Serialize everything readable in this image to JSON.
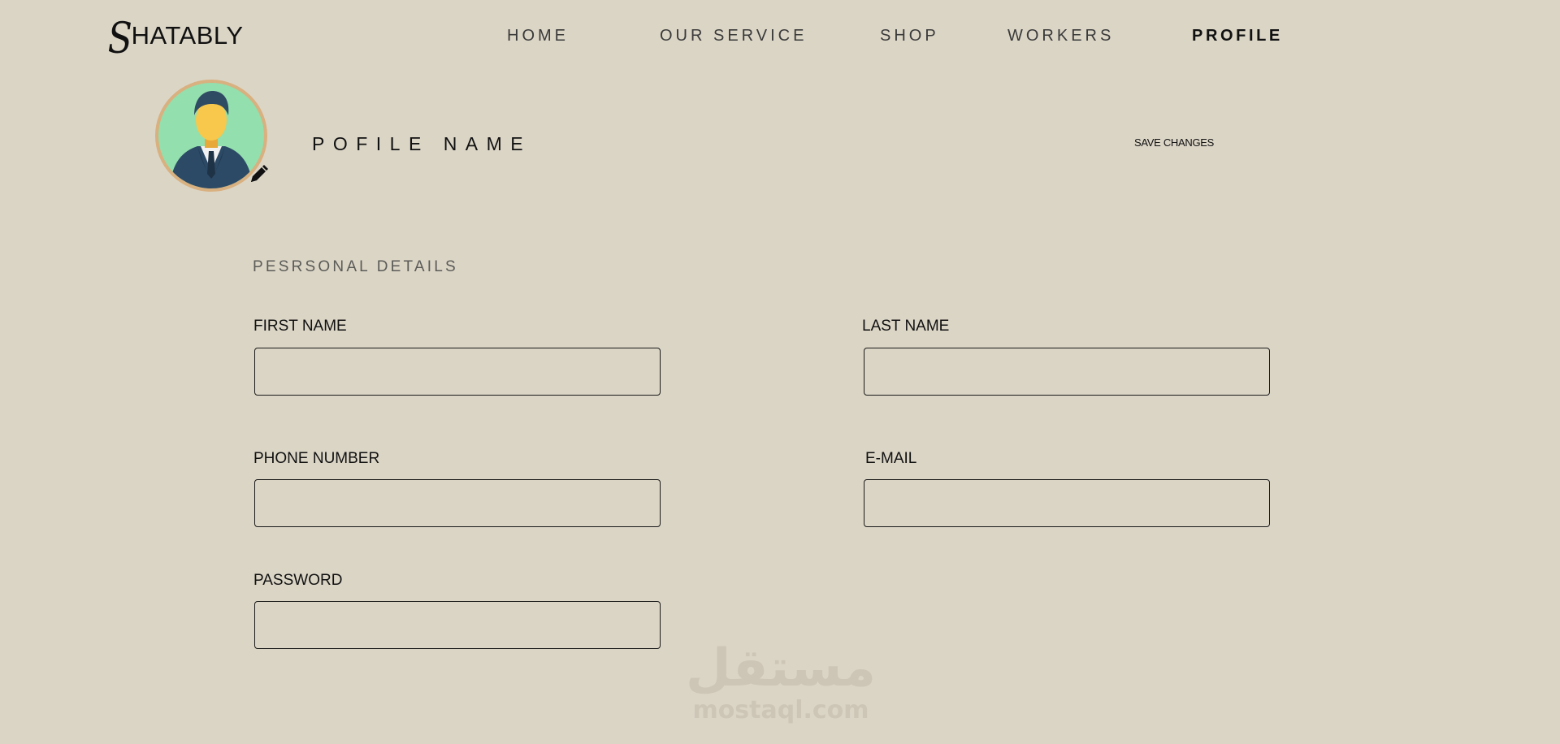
{
  "logo": {
    "initial": "S",
    "rest": "HATABLY"
  },
  "nav": {
    "items": [
      {
        "label": "HOME"
      },
      {
        "label": "OUR SERVICE"
      },
      {
        "label": "SHOP"
      },
      {
        "label": "WORKERS"
      },
      {
        "label": "PROFILE"
      }
    ],
    "active": "PROFILE"
  },
  "profile": {
    "name": "POFILE NAME",
    "save_label": "SAVE CHANGES",
    "avatar_icon": "person-avatar-icon",
    "edit_icon": "pencil-icon"
  },
  "form": {
    "section_title": "PESRSONAL DETAILS",
    "first_name": {
      "label": "FIRST NAME",
      "value": ""
    },
    "last_name": {
      "label": "LAST NAME",
      "value": ""
    },
    "phone": {
      "label": "PHONE NUMBER",
      "value": ""
    },
    "email": {
      "label": "E-MAIL",
      "value": ""
    },
    "password": {
      "label": "PASSWORD",
      "value": ""
    }
  },
  "watermark": {
    "arabic": "مستقل",
    "latin": "mostaql.com"
  },
  "colors": {
    "background": "#dbd5c6",
    "avatar_bg": "#93dfad",
    "avatar_ring": "#d9b07f",
    "text": "#111111"
  }
}
